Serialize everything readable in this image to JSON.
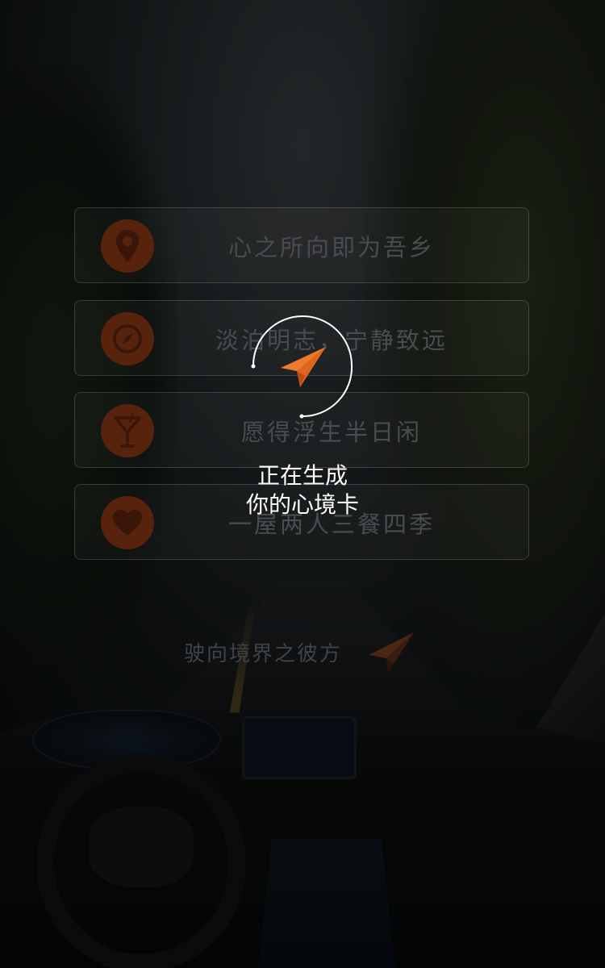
{
  "options": [
    {
      "label": "心之所向即为吾乡",
      "icon": "map-pin-icon"
    },
    {
      "label": "淡泊明志，宁静致远",
      "icon": "compass-icon"
    },
    {
      "label": "愿得浮生半日闲",
      "icon": "cocktail-icon"
    },
    {
      "label": "一屋两人三餐四季",
      "icon": "heart-icon"
    }
  ],
  "tagline": "驶向境界之彼方",
  "loading": {
    "line1": "正在生成",
    "line2": "你的心境卡"
  },
  "colors": {
    "accent": "#f07a2c",
    "icon_bg": "#58230d",
    "icon_fg": "#3a1608"
  }
}
